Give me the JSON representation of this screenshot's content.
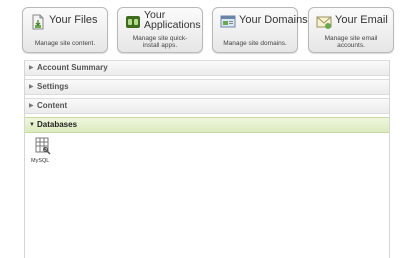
{
  "tiles": [
    {
      "title": "Your Files",
      "desc": "Manage site content.",
      "icon": "files-icon"
    },
    {
      "title": "Your Applications",
      "desc": "Manage site quick-install apps.",
      "icon": "applications-icon"
    },
    {
      "title": "Your Domains",
      "desc": "Manage site domains.",
      "icon": "domains-icon"
    },
    {
      "title": "Your Email",
      "desc": "Manage site email accounts.",
      "icon": "email-icon"
    }
  ],
  "sections": [
    {
      "label": "Account Summary",
      "expanded": false
    },
    {
      "label": "Settings",
      "expanded": false
    },
    {
      "label": "Content",
      "expanded": false
    },
    {
      "label": "Databases",
      "expanded": true
    }
  ],
  "databases": {
    "items": [
      {
        "label": "MySQL",
        "icon": "mysql-icon"
      }
    ]
  },
  "colors": {
    "expanded_header": "#dcebbf",
    "tile_border": "#b9b9b9"
  }
}
